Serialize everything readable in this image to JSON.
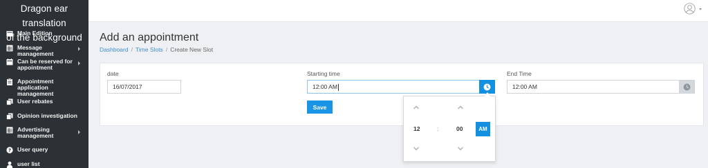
{
  "brand": {
    "line1": "Dragon ear translation",
    "line2": "of the background"
  },
  "sidebar": {
    "items": [
      {
        "label": "Main Edition",
        "icon": "dashboard-icon",
        "has_submenu": false
      },
      {
        "label": "Message management",
        "icon": "table-icon",
        "has_submenu": true
      },
      {
        "label": "Can be reserved for appointment",
        "icon": "calendar-icon",
        "has_submenu": true
      },
      {
        "label": "Appointment application management",
        "icon": "clipboard-icon",
        "has_submenu": false
      },
      {
        "label": "User rebates",
        "icon": "copy-icon",
        "has_submenu": false
      },
      {
        "label": "Opinion investigation",
        "icon": "copy-icon",
        "has_submenu": false
      },
      {
        "label": "Advertising management",
        "icon": "table-icon",
        "has_submenu": true
      },
      {
        "label": "User query",
        "icon": "question-icon",
        "has_submenu": false
      },
      {
        "label": "user list",
        "icon": "user-icon",
        "has_submenu": false
      }
    ]
  },
  "header": {
    "user_icon": "user-circle-icon"
  },
  "page": {
    "title": "Add an appointment",
    "breadcrumb": [
      "Dashboard",
      "Time Slots",
      "Create New Slot"
    ]
  },
  "form": {
    "date": {
      "label": "date",
      "value": "16/07/2017"
    },
    "start_time": {
      "label": "Starting time",
      "value": "12:00 AM"
    },
    "end_time": {
      "label": "End Time",
      "value": "12:00 AM"
    },
    "save_label": "Save"
  },
  "timepicker": {
    "hour": "12",
    "separator": ":",
    "minute": "00",
    "meridian": "AM"
  },
  "colors": {
    "sidebar_bg": "#2b3134",
    "accent": "#1490e0",
    "link": "#3d8ecb",
    "page_bg": "#eef0f4"
  }
}
